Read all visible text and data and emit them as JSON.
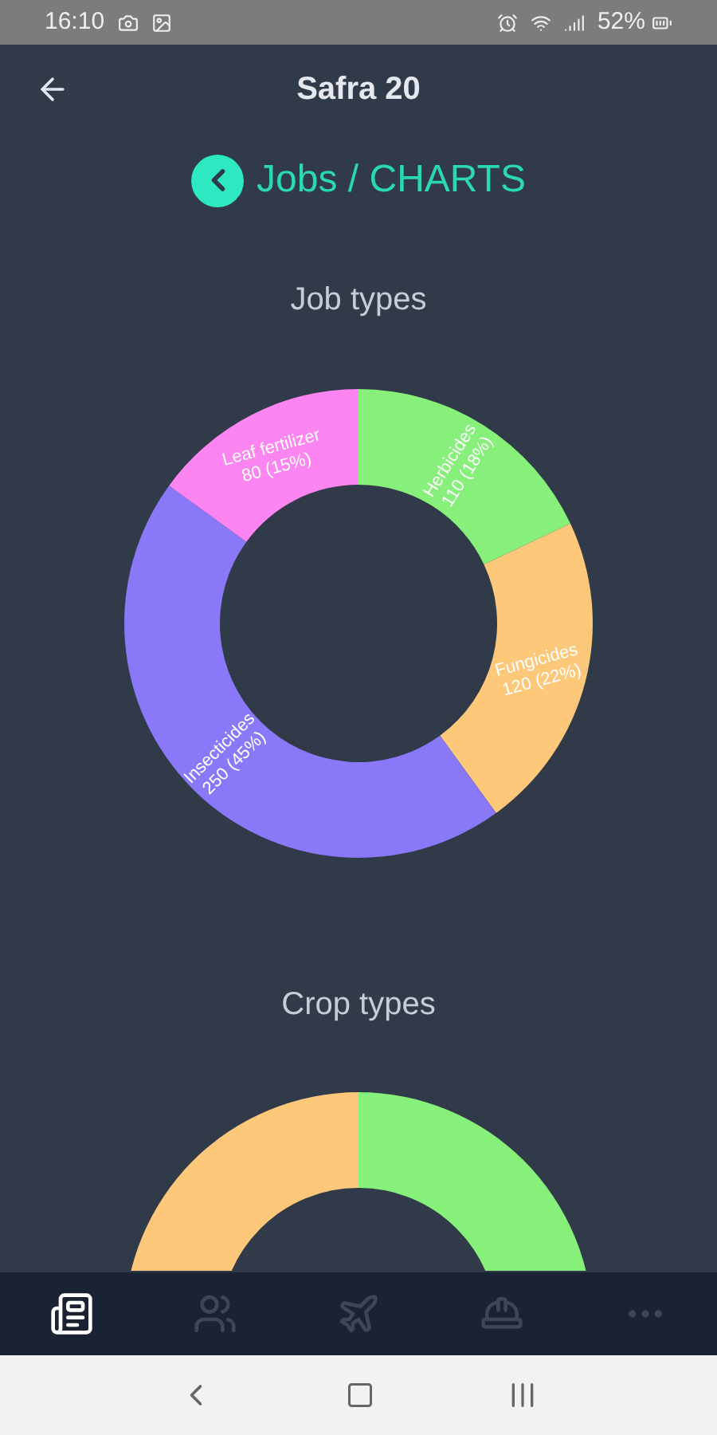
{
  "status_bar": {
    "time": "16:10",
    "battery": "52%"
  },
  "header": {
    "title": "Safra 20"
  },
  "breadcrumb": {
    "text": "Jobs / CHARTS"
  },
  "job_chart": {
    "chart_data": {
      "type": "donut",
      "title": "Job types",
      "categories": [
        "Herbicides",
        "Fungicides",
        "Insecticides",
        "Leaf fertilizer"
      ],
      "series": [
        {
          "values": [
            18,
            22,
            45,
            15
          ]
        }
      ],
      "colors": [
        "#86f07a",
        "#fdc87a",
        "#8978f8",
        "#fc85f2"
      ],
      "value_labels": [
        "110 (18%)",
        "120 (22%)",
        "250 (45%)",
        "80 (15%)"
      ]
    }
  },
  "crop_chart": {
    "title": "Crop types"
  },
  "bottom_nav": [
    {
      "selected": true
    },
    {
      "selected": false
    },
    {
      "selected": false
    },
    {
      "selected": false
    },
    {
      "selected": false
    }
  ]
}
